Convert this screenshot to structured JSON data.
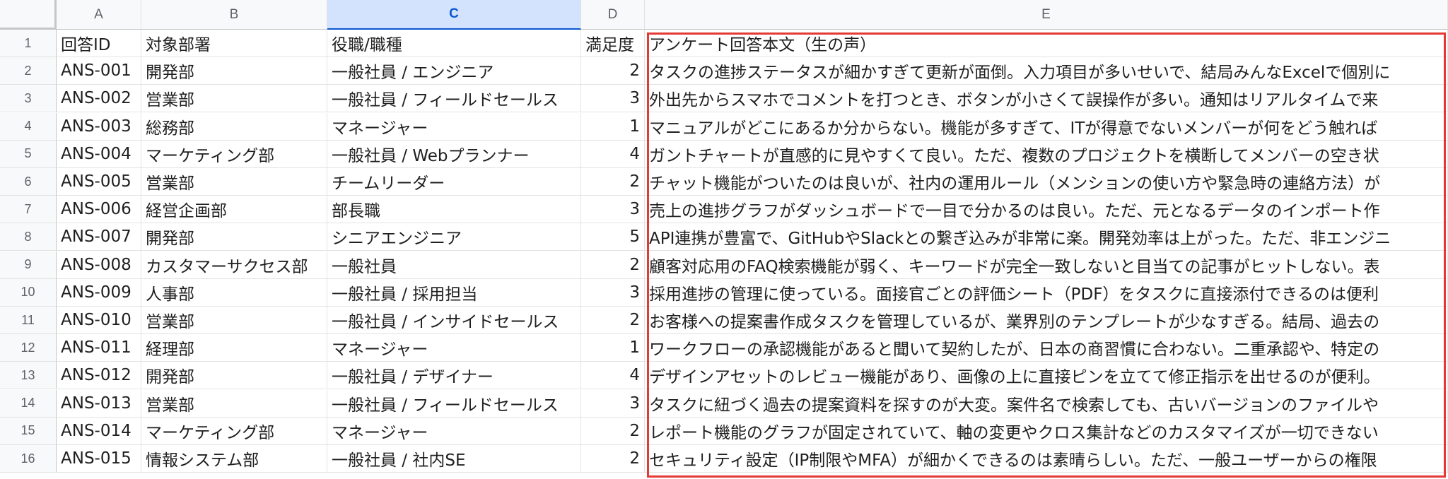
{
  "columns": [
    {
      "letter": "A",
      "selected": false
    },
    {
      "letter": "B",
      "selected": false
    },
    {
      "letter": "C",
      "selected": true
    },
    {
      "letter": "D",
      "selected": false
    },
    {
      "letter": "E",
      "selected": false
    }
  ],
  "rows": [
    {
      "num": "1",
      "id": "回答ID",
      "dept": "対象部署",
      "role": "役職/職種",
      "score": "満足度",
      "text": "アンケート回答本文（生の声）"
    },
    {
      "num": "2",
      "id": "ANS-001",
      "dept": "開発部",
      "role": "一般社員 / エンジニア",
      "score": "2",
      "text": "タスクの進捗ステータスが細かすぎて更新が面倒。入力項目が多いせいで、結局みんなExcelで個別に"
    },
    {
      "num": "3",
      "id": "ANS-002",
      "dept": "営業部",
      "role": "一般社員 / フィールドセールス",
      "score": "3",
      "text": "外出先からスマホでコメントを打つとき、ボタンが小さくて誤操作が多い。通知はリアルタイムで来"
    },
    {
      "num": "4",
      "id": "ANS-003",
      "dept": "総務部",
      "role": "マネージャー",
      "score": "1",
      "text": "マニュアルがどこにあるか分からない。機能が多すぎて、ITが得意でないメンバーが何をどう触れば"
    },
    {
      "num": "5",
      "id": "ANS-004",
      "dept": "マーケティング部",
      "role": "一般社員 / Webプランナー",
      "score": "4",
      "text": "ガントチャートが直感的に見やすくて良い。ただ、複数のプロジェクトを横断してメンバーの空き状"
    },
    {
      "num": "6",
      "id": "ANS-005",
      "dept": "営業部",
      "role": "チームリーダー",
      "score": "2",
      "text": "チャット機能がついたのは良いが、社内の運用ルール（メンションの使い方や緊急時の連絡方法）が"
    },
    {
      "num": "7",
      "id": "ANS-006",
      "dept": "経営企画部",
      "role": "部長職",
      "score": "3",
      "text": "売上の進捗グラフがダッシュボードで一目で分かるのは良い。ただ、元となるデータのインポート作"
    },
    {
      "num": "8",
      "id": "ANS-007",
      "dept": "開発部",
      "role": "シニアエンジニア",
      "score": "5",
      "text": "API連携が豊富で、GitHubやSlackとの繋ぎ込みが非常に楽。開発効率は上がった。ただ、非エンジニ"
    },
    {
      "num": "9",
      "id": "ANS-008",
      "dept": "カスタマーサクセス部",
      "role": "一般社員",
      "score": "2",
      "text": "顧客対応用のFAQ検索機能が弱く、キーワードが完全一致しないと目当ての記事がヒットしない。表"
    },
    {
      "num": "10",
      "id": "ANS-009",
      "dept": "人事部",
      "role": "一般社員 / 採用担当",
      "score": "3",
      "text": "採用進捗の管理に使っている。面接官ごとの評価シート（PDF）をタスクに直接添付できるのは便利"
    },
    {
      "num": "11",
      "id": "ANS-010",
      "dept": "営業部",
      "role": "一般社員 / インサイドセールス",
      "score": "2",
      "text": "お客様への提案書作成タスクを管理しているが、業界別のテンプレートが少なすぎる。結局、過去の"
    },
    {
      "num": "12",
      "id": "ANS-011",
      "dept": "経理部",
      "role": "マネージャー",
      "score": "1",
      "text": "ワークフローの承認機能があると聞いて契約したが、日本の商習慣に合わない。二重承認や、特定の"
    },
    {
      "num": "13",
      "id": "ANS-012",
      "dept": "開発部",
      "role": "一般社員 / デザイナー",
      "score": "4",
      "text": "デザインアセットのレビュー機能があり、画像の上に直接ピンを立てて修正指示を出せるのが便利。"
    },
    {
      "num": "14",
      "id": "ANS-013",
      "dept": "営業部",
      "role": "一般社員 / フィールドセールス",
      "score": "3",
      "text": "タスクに紐づく過去の提案資料を探すのが大変。案件名で検索しても、古いバージョンのファイルや"
    },
    {
      "num": "15",
      "id": "ANS-014",
      "dept": "マーケティング部",
      "role": "マネージャー",
      "score": "2",
      "text": "レポート機能のグラフが固定されていて、軸の変更やクロス集計などのカスタマイズが一切できない"
    },
    {
      "num": "16",
      "id": "ANS-015",
      "dept": "情報システム部",
      "role": "一般社員 / 社内SE",
      "score": "2",
      "text": "セキュリティ設定（IP制限やMFA）が細かくできるのは素晴らしい。ただ、一般ユーザーからの権限"
    }
  ],
  "colors": {
    "selection_border": "#e53935",
    "header_selected_bg": "#d3e3fd"
  }
}
